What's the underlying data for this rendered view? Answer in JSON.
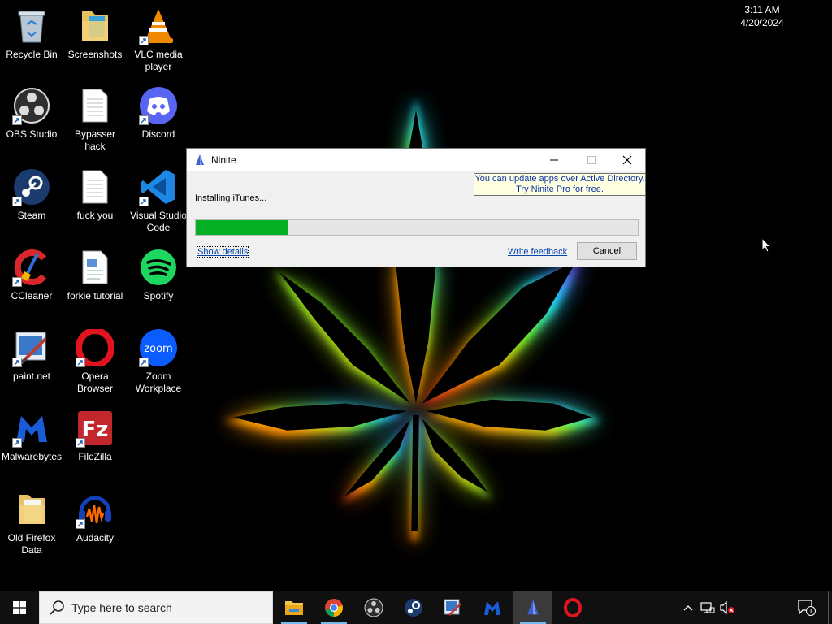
{
  "desktop": {
    "icons": [
      {
        "label": "Recycle Bin"
      },
      {
        "label": "Screenshots"
      },
      {
        "label": "VLC media player"
      },
      {
        "label": "OBS Studio"
      },
      {
        "label": "Bypasser hack"
      },
      {
        "label": "Discord"
      },
      {
        "label": "Steam"
      },
      {
        "label": "fuck you"
      },
      {
        "label": "Visual Studio Code"
      },
      {
        "label": "CCleaner"
      },
      {
        "label": "forkie tutorial"
      },
      {
        "label": "Spotify"
      },
      {
        "label": "paint.net"
      },
      {
        "label": "Opera Browser"
      },
      {
        "label": "Zoom Workplace"
      },
      {
        "label": "Malwarebytes"
      },
      {
        "label": "FileZilla"
      },
      {
        "label": "Old Firefox Data"
      },
      {
        "label": "Audacity"
      }
    ]
  },
  "ninite_window": {
    "title": "Ninite",
    "ad_line1": "You can update apps over Active Directory.",
    "ad_line2": "Try Ninite Pro for free.",
    "status": "Installing iTunes...",
    "progress_percent": 21,
    "show_details_label": "Show details",
    "write_feedback_label": "Write feedback",
    "cancel_label": "Cancel"
  },
  "taskbar": {
    "search_placeholder": "Type here to search",
    "apps": [
      "file-explorer",
      "chrome",
      "obs-studio",
      "steam",
      "paint-net",
      "malwarebytes",
      "ninite",
      "opera"
    ],
    "clock_time": "3:11 AM",
    "clock_date": "4/20/2024",
    "notification_count": "1"
  },
  "colors": {
    "progress_fill": "#06b025",
    "ad_background": "#ffffe1",
    "ad_text": "#0a2fa8",
    "link": "#0645ad",
    "taskbar": "#101010"
  }
}
